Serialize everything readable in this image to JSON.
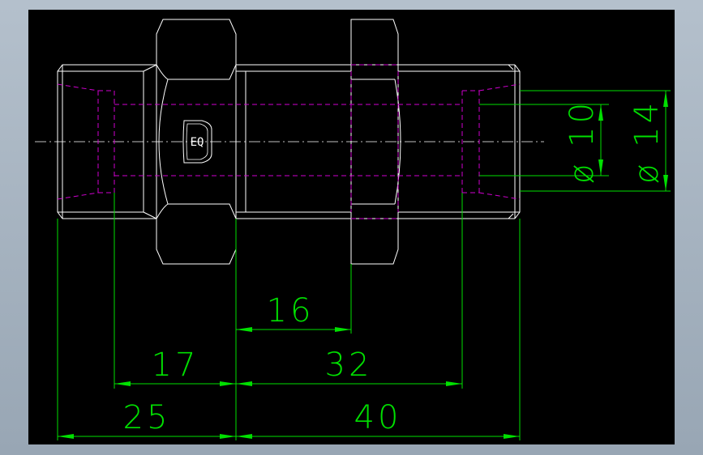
{
  "drawing": {
    "colors": {
      "background": "#000000",
      "outline": "#ffffff",
      "hidden": "#d000d0",
      "dimension": "#00e000",
      "centerline": "#ffffff"
    },
    "dimensions": {
      "d16": "16",
      "d17": "17",
      "d32": "32",
      "d25": "25",
      "d40": "40",
      "dia10": "ø 10",
      "dia14": "ø 14"
    },
    "logo_text": "EQ"
  }
}
